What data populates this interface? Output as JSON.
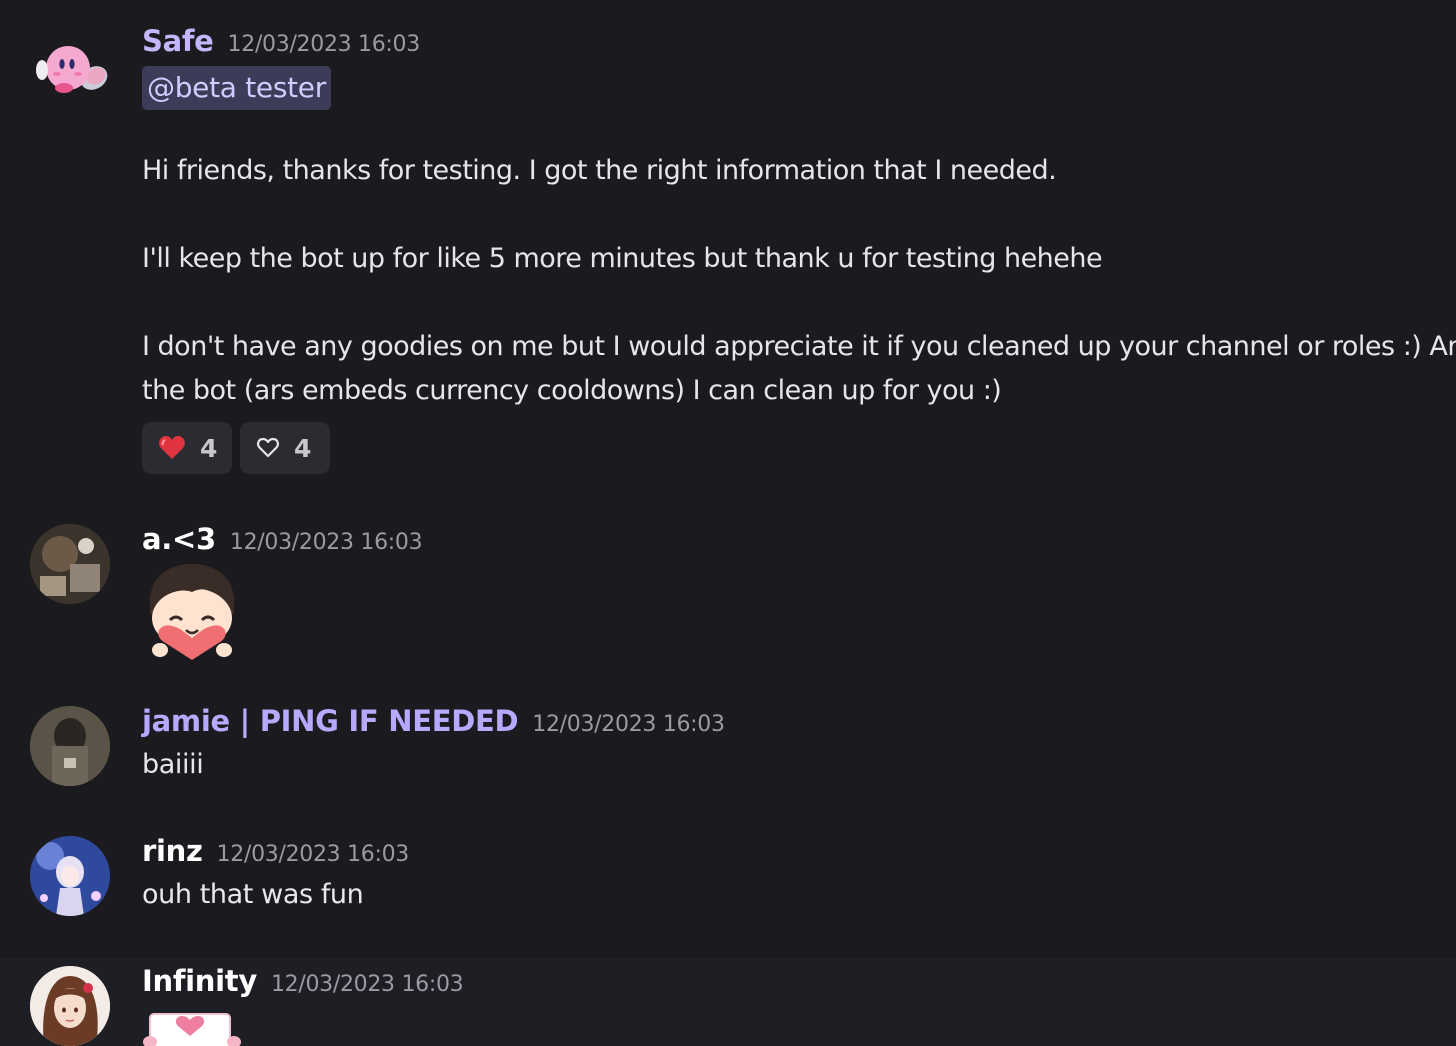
{
  "messages": [
    {
      "username": "Safe",
      "username_color": "#c4b5fd",
      "timestamp": "12/03/2023 16:03",
      "mention": "@beta tester",
      "lines": [
        "Hi friends, thanks for testing. I got the right information that I needed.",
        "I'll keep the bot up for like 5 more minutes but thank u for testing hehehe",
        "I don't have any goodies on me but I would appreciate it if you cleaned up your channel or roles :) Anything for",
        "the bot (ars embeds currency cooldowns) I can clean up for you :)"
      ],
      "reactions": [
        {
          "emoji": "red-heart-icon",
          "count": "4"
        },
        {
          "emoji": "outline-heart-icon",
          "count": "4"
        }
      ]
    },
    {
      "username": "a.<3",
      "username_color": "#ffffff",
      "timestamp": "12/03/2023 16:03",
      "sticker": "chibi-heart-sticker"
    },
    {
      "username": "jamie | PING IF NEEDED",
      "username_color": "#b9a8ff",
      "timestamp": "12/03/2023 16:03",
      "text": "baiiii"
    },
    {
      "username": "rinz",
      "username_color": "#ffffff",
      "timestamp": "12/03/2023 16:03",
      "text": "ouh that was fun"
    },
    {
      "username": "Infinity",
      "username_color": "#ffffff",
      "timestamp": "12/03/2023 16:03",
      "sticker": "love-letter-sticker"
    }
  ]
}
